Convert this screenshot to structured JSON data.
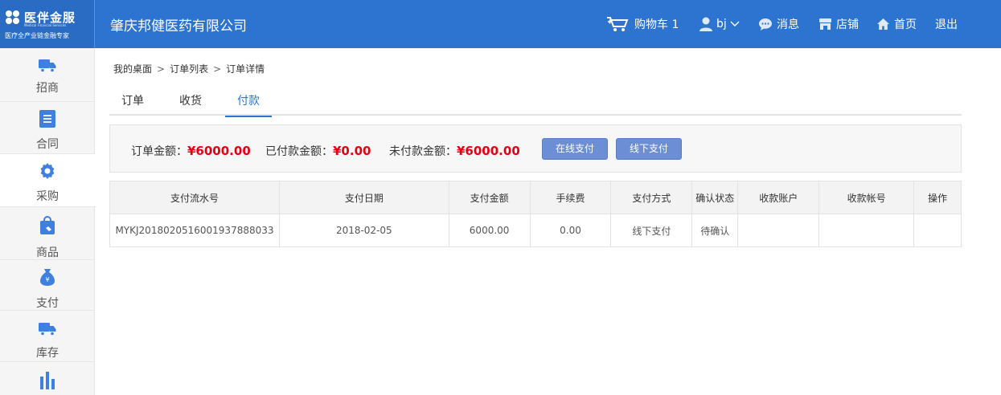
{
  "header": {
    "logo_name": "医伴金服",
    "logo_en": "Medical Financial Services",
    "logo_slogan": "医疗全产业链金融专家",
    "company": "肇庆邦健医药有限公司",
    "nav": {
      "cart": "购物车 1",
      "user": "bj",
      "messages": "消息",
      "store": "店铺",
      "home": "首页",
      "logout": "退出"
    },
    "bg_color": "#2d74d0"
  },
  "sidebar": {
    "items": [
      {
        "label": "招商",
        "icon": "truck-icon"
      },
      {
        "label": "合同",
        "icon": "document-icon"
      },
      {
        "label": "采购",
        "icon": "gear-icon",
        "active": true
      },
      {
        "label": "商品",
        "icon": "shopping-bag-icon"
      },
      {
        "label": "支付",
        "icon": "money-bag-icon"
      },
      {
        "label": "库存",
        "icon": "truck-icon"
      },
      {
        "label": "",
        "icon": "bar-chart-icon"
      }
    ]
  },
  "breadcrumb": [
    "我的桌面",
    "订单列表",
    "订单详情"
  ],
  "breadcrumb_sep": ">",
  "tabs": [
    "订单",
    "收货",
    "付款"
  ],
  "active_tab": "付款",
  "summary": {
    "order_amount_label": "订单金额：",
    "order_amount": "¥6000.00",
    "paid_label": "已付款金额：",
    "paid": "¥0.00",
    "unpaid_label": "未付款金额：",
    "unpaid": "¥6000.00",
    "online_pay": "在线支付",
    "offline_pay": "线下支付",
    "money_color": "#e60012"
  },
  "table": {
    "headers": [
      "支付流水号",
      "支付日期",
      "支付金额",
      "手续费",
      "支付方式",
      "确认状态",
      "收款账户",
      "收款帐号",
      "操作"
    ],
    "rows": [
      [
        "MYKJ2018020516001937888033",
        "2018-02-05",
        "6000.00",
        "0.00",
        "线下支付",
        "待确认",
        "",
        "",
        ""
      ]
    ]
  }
}
